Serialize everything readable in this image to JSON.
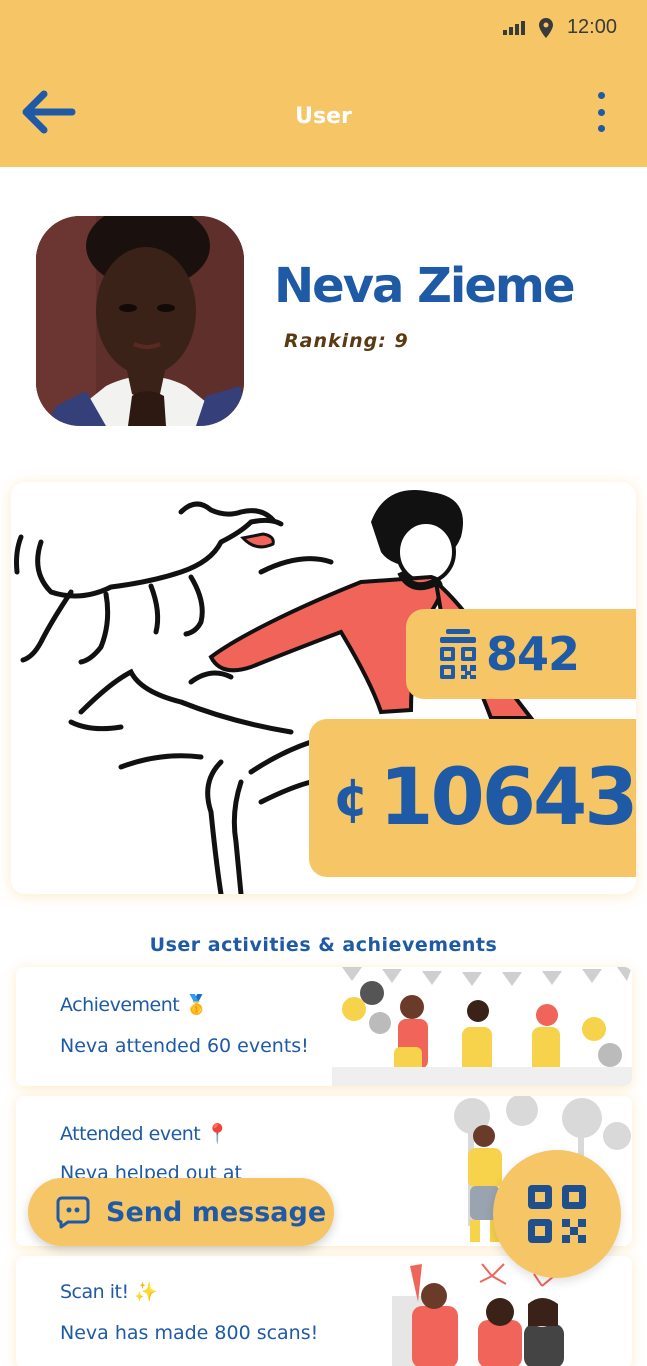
{
  "status_bar": {
    "time": "12:00"
  },
  "header": {
    "title": "User"
  },
  "profile": {
    "name": "Neva Zieme",
    "ranking": "Ranking: 9"
  },
  "stats": {
    "scans": "842",
    "currency_symbol": "¢",
    "coins": "10643"
  },
  "activities": {
    "section_title": "User activities & achievements",
    "items": [
      {
        "title": "Achievement",
        "emoji": "🥇",
        "description": "Neva attended 60 events!"
      },
      {
        "title": "Attended event",
        "emoji": "📍",
        "description": "Neva helped out at"
      },
      {
        "title": "Scan it!",
        "emoji": "✨",
        "description": "Neva has made 800 scans!"
      }
    ]
  },
  "actions": {
    "send_message": "Send message"
  },
  "colors": {
    "primary_yellow": "#f6c566",
    "primary_blue": "#1f5aa6",
    "accent_red": "#f0645a"
  },
  "icons": {
    "back": "arrow-left-icon",
    "menu": "more-vertical-icon",
    "scan": "qr-code-icon",
    "message": "chat-bubble-icon",
    "location": "location-pin-icon",
    "signal": "signal-icon"
  }
}
